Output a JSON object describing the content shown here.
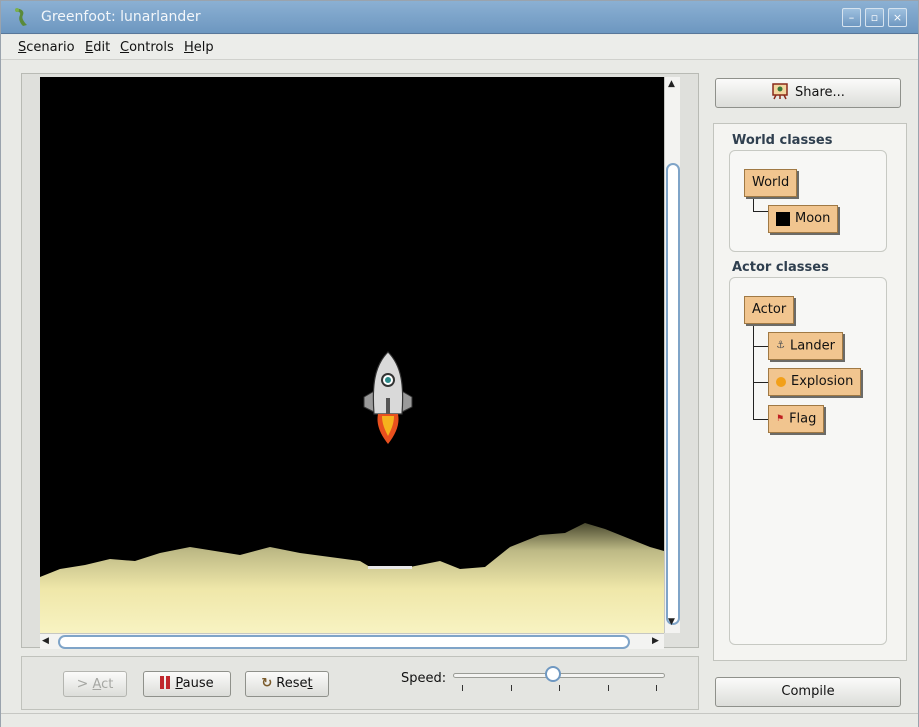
{
  "window": {
    "title": "Greenfoot: lunarlander"
  },
  "menu": [
    {
      "u": "S",
      "rest": "cenario"
    },
    {
      "u": "E",
      "rest": "dit"
    },
    {
      "u": "C",
      "rest": "ontrols"
    },
    {
      "u": "H",
      "rest": "elp"
    }
  ],
  "controls": {
    "act": {
      "u": "A",
      "rest": "ct"
    },
    "pause": {
      "u": "P",
      "rest": "ause"
    },
    "reset": {
      "pre": "Rese",
      "u": "t"
    },
    "speed_label": "Speed:",
    "speed_fraction": 0.47
  },
  "sidebar": {
    "share_label": "Share...",
    "compile_label": "Compile",
    "world_classes_title": "World classes",
    "actor_classes_title": "Actor classes",
    "world_classes": [
      "World",
      "Moon"
    ],
    "actor_classes": [
      "Actor",
      "Lander",
      "Explosion",
      "Flag"
    ]
  },
  "colors": {
    "class_box": "#f1c58f",
    "world_bg": "#000000",
    "terrain": "#f3ecb0",
    "titlebar": "#7aa2c9"
  },
  "icons": {
    "app": "greenfoot-icon",
    "share": "share-easel-icon",
    "act": "act-arrow-icon",
    "pause": "pause-icon",
    "reset": "reset-icon"
  }
}
